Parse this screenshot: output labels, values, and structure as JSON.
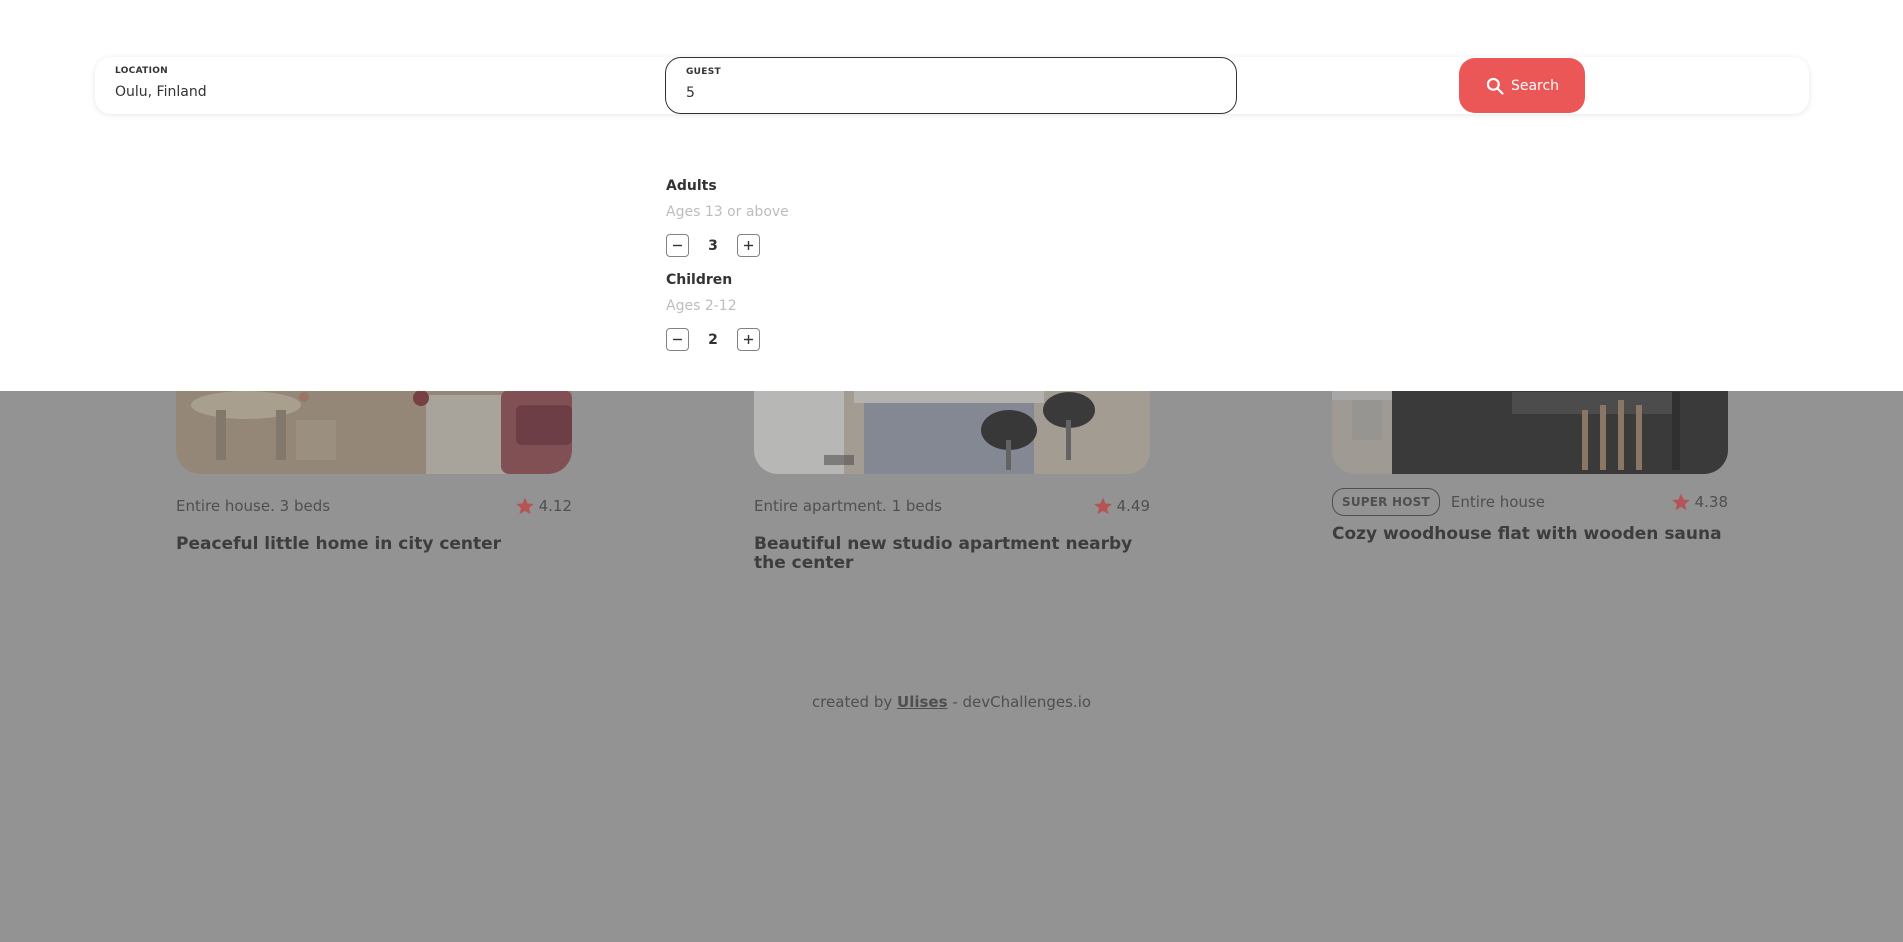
{
  "search": {
    "location_label": "LOCATION",
    "location_value": "Oulu, Finland",
    "guest_label": "GUEST",
    "guest_value": "5",
    "search_button": "Search",
    "search_icon": "search-icon"
  },
  "guests": {
    "adults": {
      "title": "Adults",
      "subtitle": "Ages 13 or above",
      "count": "3"
    },
    "children": {
      "title": "Children",
      "subtitle": "Ages 2-12",
      "count": "2"
    }
  },
  "listings": [
    {
      "type": "Entire house. 3 beds",
      "rating": "4.12",
      "title": "Peaceful little home in city center",
      "superhost": false
    },
    {
      "type": "Entire apartment. 1 beds",
      "rating": "4.49",
      "title": "Beautiful new studio apartment nearby the center",
      "superhost": false
    },
    {
      "type": "Entire house",
      "rating": "4.38",
      "title": "Cozy woodhouse flat with wooden sauna",
      "superhost": true,
      "superhost_label": "SUPER HOST"
    }
  ],
  "footer": {
    "prefix": "created by",
    "author": "Ulises",
    "suffix": "- devChallenges.io"
  },
  "colors": {
    "accent": "#eb5757",
    "overlay": "#b7b7b7",
    "text": "#333333"
  }
}
